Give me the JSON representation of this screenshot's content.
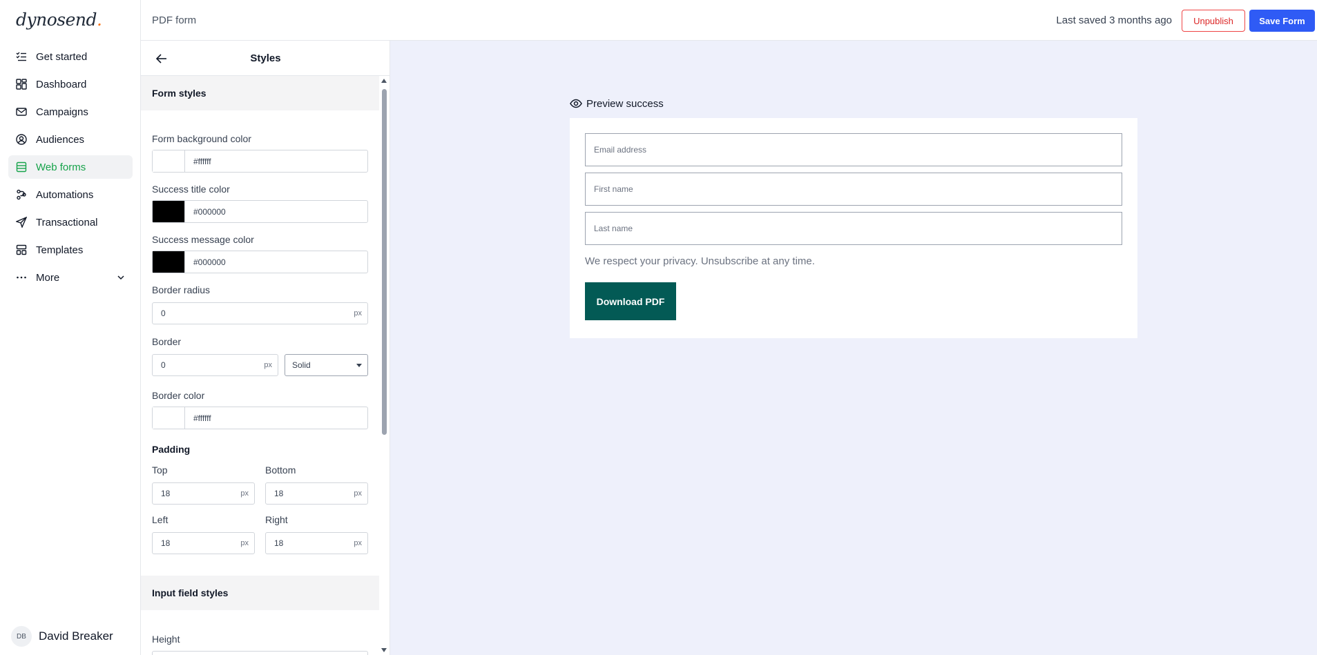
{
  "app": {
    "logo_text": "dynosend",
    "logo_dot": "."
  },
  "sidebar": {
    "items": [
      {
        "label": "Get started",
        "icon": "checklist-icon"
      },
      {
        "label": "Dashboard",
        "icon": "dashboard-icon"
      },
      {
        "label": "Campaigns",
        "icon": "mail-icon"
      },
      {
        "label": "Audiences",
        "icon": "user-circle-icon"
      },
      {
        "label": "Web forms",
        "icon": "form-icon",
        "active": true
      },
      {
        "label": "Automations",
        "icon": "automation-icon"
      },
      {
        "label": "Transactional",
        "icon": "send-icon"
      },
      {
        "label": "Templates",
        "icon": "template-icon"
      },
      {
        "label": "More",
        "icon": "more-dots-icon"
      }
    ],
    "user": {
      "initials": "DB",
      "name": "David Breaker"
    }
  },
  "topbar": {
    "form_name": "PDF form",
    "last_saved": "Last saved 3 months ago",
    "unpublish_label": "Unpublish",
    "save_label": "Save Form"
  },
  "panel": {
    "title": "Styles",
    "form_styles": {
      "heading": "Form styles",
      "background_color_label": "Form background color",
      "background_color": "#ffffff",
      "success_title_color_label": "Success title color",
      "success_title_color": "#000000",
      "success_message_color_label": "Success message color",
      "success_message_color": "#000000",
      "border_radius_label": "Border radius",
      "border_radius": "0",
      "border_label": "Border",
      "border_width": "0",
      "border_style": "Solid",
      "border_color_label": "Border color",
      "border_color": "#ffffff",
      "unit": "px",
      "padding_heading": "Padding",
      "padding": {
        "top_label": "Top",
        "top": "18",
        "bottom_label": "Bottom",
        "bottom": "18",
        "left_label": "Left",
        "left": "18",
        "right_label": "Right",
        "right": "18"
      }
    },
    "input_styles": {
      "heading": "Input field styles",
      "height_label": "Height"
    }
  },
  "preview": {
    "label": "Preview success",
    "email_placeholder": "Email address",
    "first_name_placeholder": "First name",
    "last_name_placeholder": "Last name",
    "privacy_text": "We respect your privacy. Unsubscribe at any time.",
    "button_label": "Download PDF",
    "button_color": "#035a55"
  }
}
